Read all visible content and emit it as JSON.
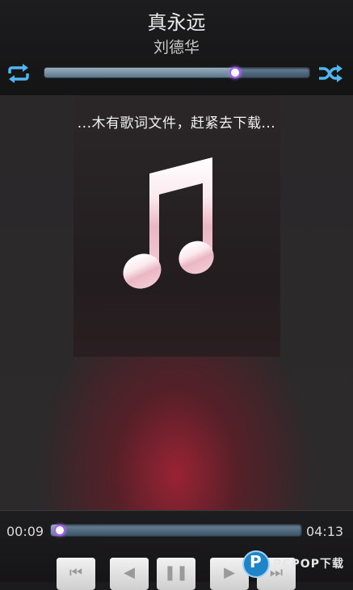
{
  "song": {
    "title": "真永远",
    "artist": "刘德华"
  },
  "controls_top": {
    "repeat_icon": "repeat-icon",
    "shuffle_icon": "shuffle-icon",
    "volume_level": 0.72
  },
  "lyrics": {
    "message": "...木有歌词文件，赶紧去下载..."
  },
  "album_art": {
    "icon": "music-note-icon"
  },
  "playback": {
    "elapsed": "00:09",
    "total": "04:13",
    "progress": 0.036
  },
  "buttons": [
    {
      "name": "prev-button",
      "icon": "skip-previous-icon"
    },
    {
      "name": "rewind-button",
      "icon": "rewind-icon"
    },
    {
      "name": "pause-button",
      "icon": "pause-icon"
    },
    {
      "name": "forward-button",
      "icon": "fast-forward-icon"
    },
    {
      "name": "next-button",
      "icon": "skip-next-icon"
    }
  ],
  "watermark": {
    "logo_text": "PCPOP下载"
  },
  "colors": {
    "accent_thumb": "#a85cf0",
    "icon_blue": "#4fb6ef",
    "glow_red": "#a02234"
  }
}
